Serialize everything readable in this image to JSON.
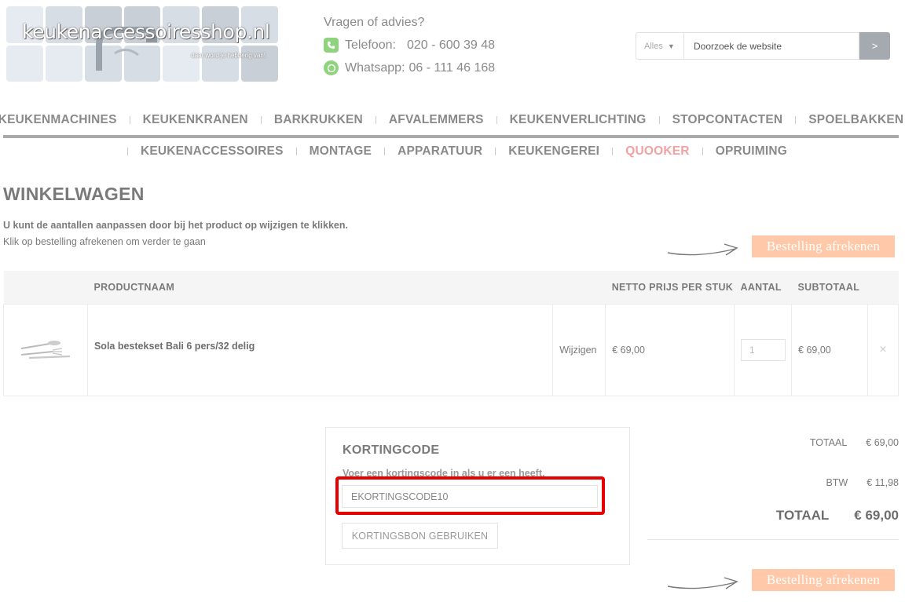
{
  "header": {
    "logo_text": "keukenaccessoiresshop.nl",
    "logo_slogan": "daar word je hebberig van!",
    "contact_question": "Vragen of advies?",
    "phone_label": "Telefoon:",
    "phone_number": "020 - 600 39 48",
    "whatsapp_label": "Whatsapp:",
    "whatsapp_number": "06 - 111 46 168",
    "search": {
      "scope": "Alles",
      "placeholder": "Doorzoek de website",
      "button_label": ">"
    }
  },
  "nav": {
    "row1": [
      "KEUKENMACHINES",
      "KEUKENKRANEN",
      "BARKRUKKEN",
      "AFVALEMMERS",
      "KEUKENVERLICHTING",
      "STOPCONTACTEN",
      "SPOELBAKKEN"
    ],
    "row2": [
      "KEUKENACCESSOIRES",
      "MONTAGE",
      "APPARATUUR",
      "KEUKENGEREI",
      "QUOOKER",
      "OPRUIMING"
    ]
  },
  "page": {
    "title": "WINKELWAGEN",
    "intro_bold": "U kunt de aantallen aanpassen door bij het product op wijzigen te klikken.",
    "intro_text": "Klik op bestelling afrekenen om verder te gaan",
    "checkout_label": "Bestelling afrekenen"
  },
  "cart": {
    "headers": {
      "product": "PRODUCTNAAM",
      "price": "NETTO PRIJS PER STUK",
      "qty": "AANTAL",
      "subtotal": "SUBTOTAAL"
    },
    "items": [
      {
        "name": "Sola bestekset Bali 6 pers/32 delig",
        "edit_label": "Wijzigen",
        "price": "€ 69,00",
        "qty": "1",
        "subtotal": "€ 69,00",
        "remove": "×"
      }
    ]
  },
  "coupon": {
    "title": "KORTINGCODE",
    "hint": "Voer een kortingscode in als u er een heeft.",
    "code_value": "EKORTINGSCODE10",
    "apply_label": "KORTINGSBON GEBRUIKEN"
  },
  "totals": {
    "total_label": "TOTAAL",
    "total_value": "€ 69,00",
    "vat_label": "BTW",
    "vat_value": "€ 11,98",
    "grand_label": "TOTAAL",
    "grand_value": "€ 69,00"
  },
  "colors": {
    "accent_checkout": "#ffc8a8",
    "highlight_nav": "#f2a1a1",
    "highlight_box": "#e60000"
  }
}
